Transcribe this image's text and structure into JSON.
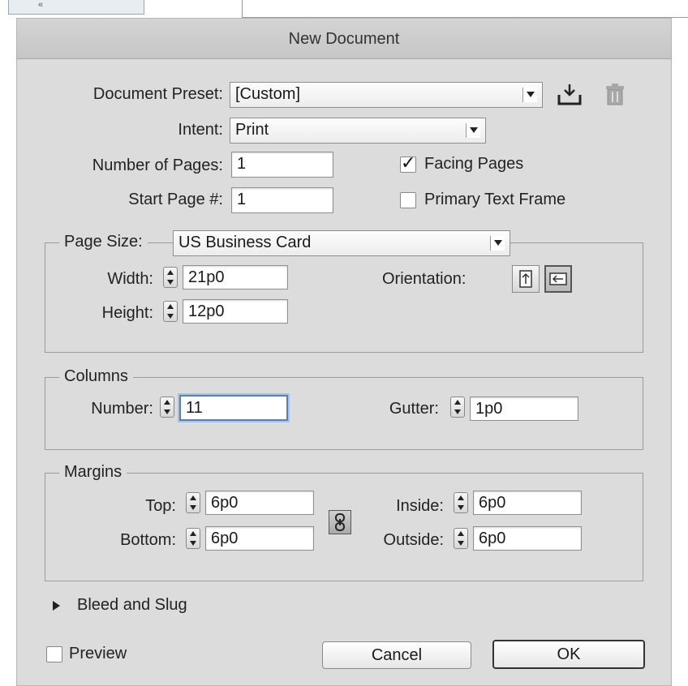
{
  "background": {
    "mark": "«"
  },
  "dialog": {
    "title": "New Document",
    "preset": {
      "label": "Document Preset:",
      "value": "[Custom]"
    },
    "intent": {
      "label": "Intent:",
      "value": "Print"
    },
    "num_pages": {
      "label": "Number of Pages:",
      "value": "1"
    },
    "start_page": {
      "label": "Start Page #:",
      "value": "1"
    },
    "facing_pages": {
      "label": "Facing Pages",
      "checked": true
    },
    "primary_text_frame": {
      "label": "Primary Text Frame",
      "checked": false
    },
    "page_size": {
      "label": "Page Size:",
      "value": "US Business Card",
      "width_label": "Width:",
      "width": "21p0",
      "height_label": "Height:",
      "height": "12p0",
      "orientation_label": "Orientation:",
      "orientation_selected": "landscape"
    },
    "columns": {
      "label": "Columns",
      "number_label": "Number:",
      "number": "11",
      "gutter_label": "Gutter:",
      "gutter": "1p0"
    },
    "margins": {
      "label": "Margins",
      "top_label": "Top:",
      "top": "6p0",
      "bottom_label": "Bottom:",
      "bottom": "6p0",
      "inside_label": "Inside:",
      "inside": "6p0",
      "outside_label": "Outside:",
      "outside": "6p0"
    },
    "bleed_slug_label": "Bleed and Slug",
    "preview": {
      "label": "Preview",
      "checked": false
    },
    "cancel_label": "Cancel",
    "ok_label": "OK"
  }
}
